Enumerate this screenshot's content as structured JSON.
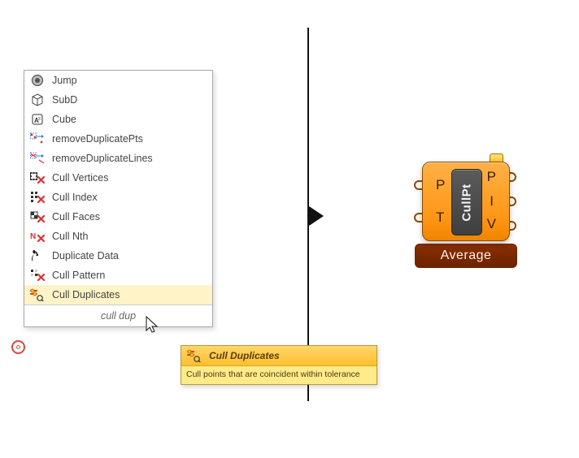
{
  "menu": {
    "items": [
      {
        "label": "Jump",
        "icon": "jump-icon",
        "selected": false
      },
      {
        "label": "SubD",
        "icon": "subd-icon",
        "selected": false
      },
      {
        "label": "Cube",
        "icon": "cube-icon",
        "selected": false
      },
      {
        "label": "removeDuplicatePts",
        "icon": "remove-pts-icon",
        "selected": false
      },
      {
        "label": "removeDuplicateLines",
        "icon": "remove-lines-icon",
        "selected": false
      },
      {
        "label": "Cull Vertices",
        "icon": "cull-vertices-icon",
        "selected": false
      },
      {
        "label": "Cull Index",
        "icon": "cull-index-icon",
        "selected": false
      },
      {
        "label": "Cull Faces",
        "icon": "cull-faces-icon",
        "selected": false
      },
      {
        "label": "Cull Nth",
        "icon": "cull-nth-icon",
        "selected": false
      },
      {
        "label": "Duplicate Data",
        "icon": "duplicate-data-icon",
        "selected": false
      },
      {
        "label": "Cull Pattern",
        "icon": "cull-pattern-icon",
        "selected": false
      },
      {
        "label": "Cull Duplicates",
        "icon": "cull-duplicates-icon",
        "selected": true
      }
    ],
    "search_value": "cull dup"
  },
  "tooltip": {
    "title": "Cull Duplicates",
    "body": "Cull points that are coincident within tolerance",
    "icon": "cull-duplicates-icon"
  },
  "component": {
    "center_name": "CullPt",
    "caption": "Average",
    "inputs": [
      {
        "letter": "P"
      },
      {
        "letter": "T"
      }
    ],
    "outputs": [
      {
        "letter": "P"
      },
      {
        "letter": "I"
      },
      {
        "letter": "V"
      }
    ]
  }
}
